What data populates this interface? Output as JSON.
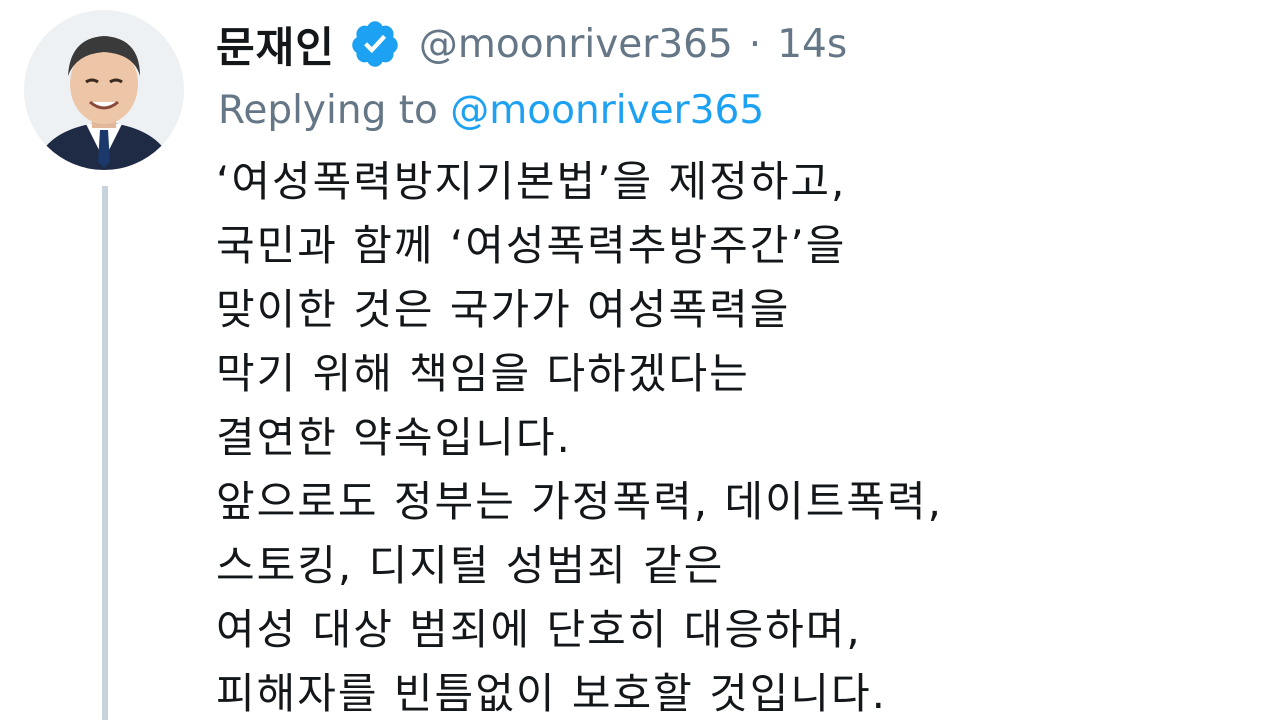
{
  "tweet": {
    "display_name": "문재인",
    "handle": "@moonriver365",
    "separator": "·",
    "time": "14s",
    "replying_prefix": "Replying to",
    "replying_handle": "@moonriver365",
    "lines": [
      "‘여성폭력방지기본법’을 제정하고,",
      "국민과 함께 ‘여성폭력추방주간’을",
      "맞이한 것은 국가가 여성폭력을",
      "막기 위해 책임을 다하겠다는",
      "결연한 약속입니다.",
      "앞으로도 정부는 가정폭력, 데이트폭력,",
      "스토킹, 디지털 성범죄 같은",
      "여성 대상 범죄에 단호히 대응하며,",
      "피해자를 빈틈없이 보호할 것입니다."
    ]
  },
  "icons": {
    "verified": "verified-badge-icon",
    "avatar": "profile-photo"
  },
  "colors": {
    "accent": "#1da1f2",
    "text": "#14171a",
    "muted": "#657786",
    "thread_line": "#c9d3dc"
  }
}
